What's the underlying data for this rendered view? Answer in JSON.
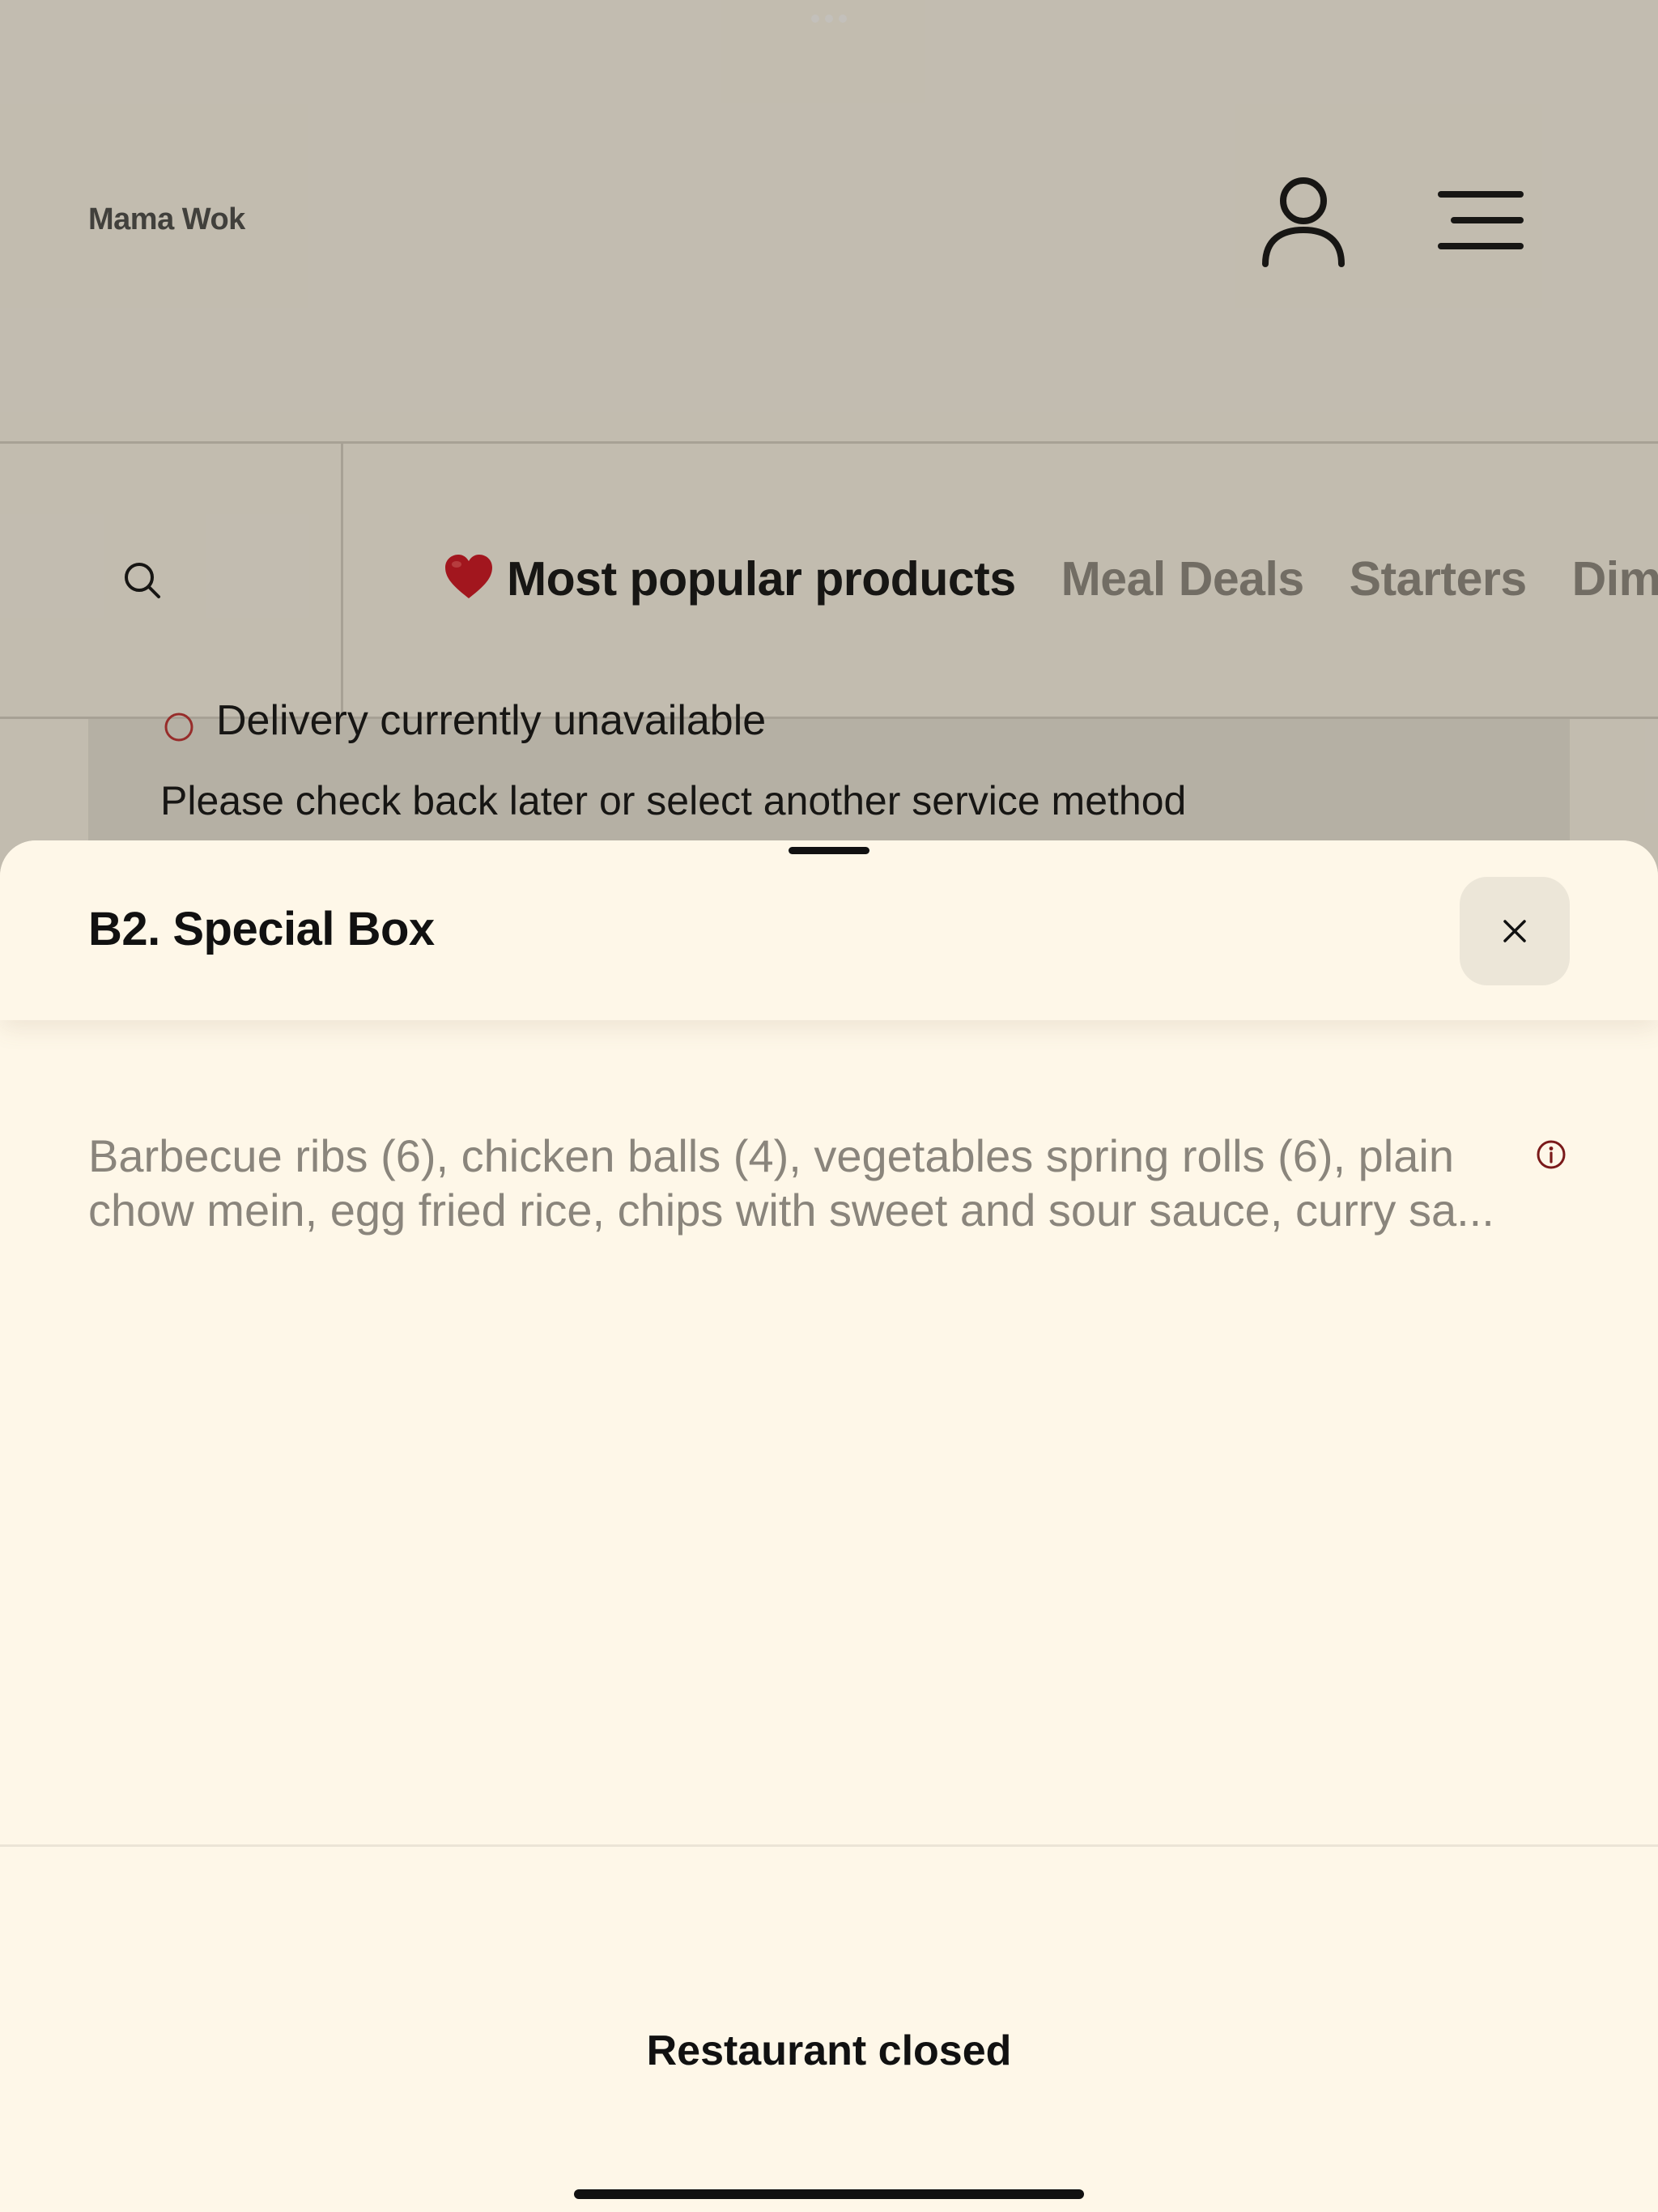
{
  "header": {
    "brand": "Mama Wok",
    "account_icon": "person-icon",
    "menu_icon": "hamburger-menu-icon"
  },
  "categories": {
    "search_icon": "search-icon",
    "tabs": [
      {
        "label": "Most popular products",
        "icon": "heart-icon",
        "active": true
      },
      {
        "label": "Meal Deals",
        "active": false
      },
      {
        "label": "Starters",
        "active": false
      },
      {
        "label": "Dim",
        "active": false
      }
    ]
  },
  "notice": {
    "title": "Delivery currently unavailable",
    "text": "Please check back later or select another service method"
  },
  "product_sheet": {
    "title": "B2. Special Box",
    "close_icon": "close-icon",
    "description": "Barbecue ribs (6), chicken balls (4), vegetables spring rolls (6), plain chow mein, egg fried rice, chips with sweet and sour sauce, curry sa...",
    "info_icon": "info-icon",
    "status": "Restaurant closed"
  },
  "colors": {
    "background": "#fef7e8",
    "heart": "#d1111f",
    "info": "#7a1a1a"
  }
}
